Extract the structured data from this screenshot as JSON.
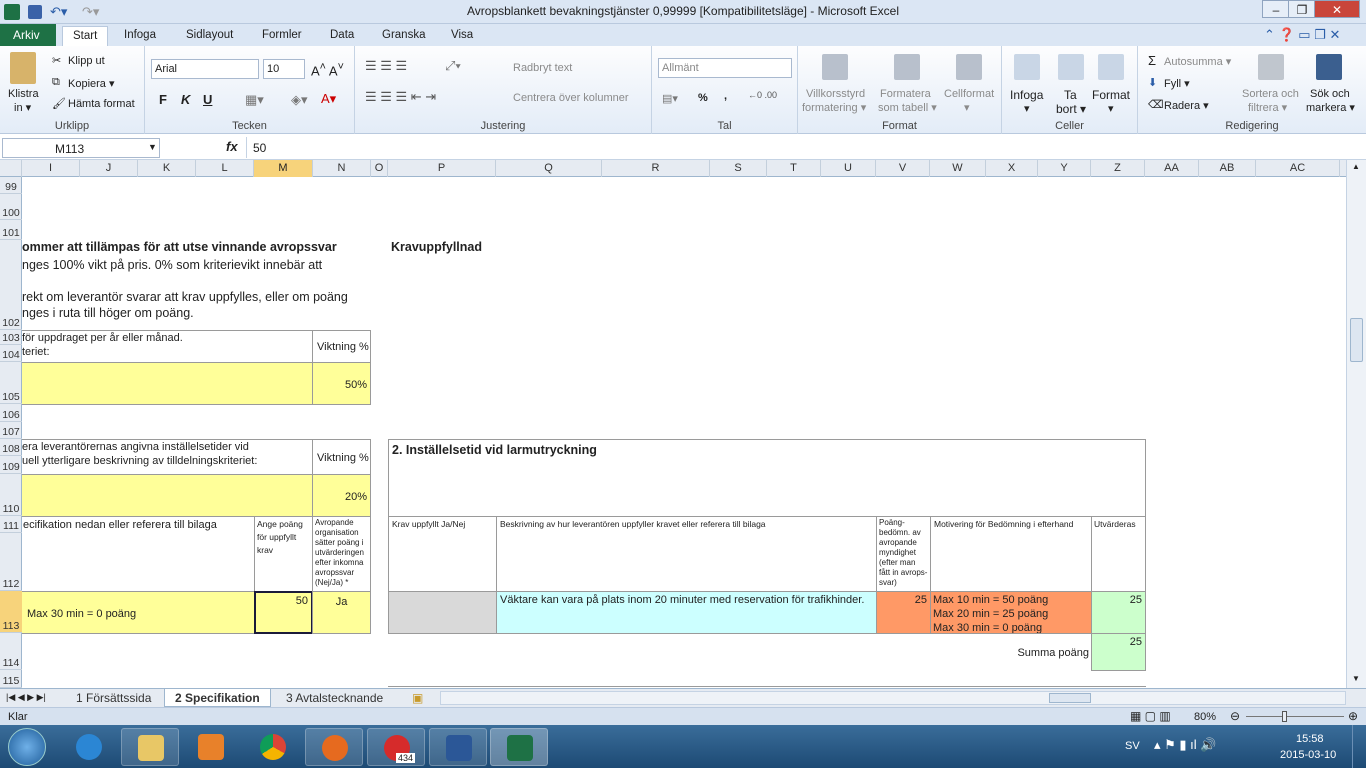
{
  "window": {
    "title": "Avropsblankett bevakningstjänster 0,99999  [Kompatibilitetsläge]  -  Microsoft Excel",
    "minimize": "–",
    "restore": "❐",
    "close": "✕"
  },
  "tabs": [
    "Arkiv",
    "Start",
    "Infoga",
    "Sidlayout",
    "Formler",
    "Data",
    "Granska",
    "Visa"
  ],
  "ribbon": {
    "clipboard": {
      "paste": "Klistra",
      "paste2": "in ▾",
      "cut": "Klipp ut",
      "copy": "Kopiera ▾",
      "format_painter": "Hämta format",
      "label": "Urklipp"
    },
    "font": {
      "name": "Arial",
      "size": "10",
      "bold": "F",
      "italic": "K",
      "underline": "U",
      "label": "Tecken"
    },
    "alignment": {
      "wrap": "Radbryt text",
      "merge": "Centrera över kolumner",
      "label": "Justering"
    },
    "number": {
      "format": "Allmänt",
      "percent": "%",
      "comma": ",",
      "label": "Tal"
    },
    "styles": {
      "conditional": "Villkorsstyrd",
      "conditional2": "formatering ▾",
      "table": "Formatera",
      "table2": "som tabell ▾",
      "cell": "Cellformat",
      "cell2": "▾",
      "label": "Format"
    },
    "cells": {
      "insert": "Infoga",
      "insert2": "▾",
      "delete": "Ta",
      "delete2": "bort ▾",
      "format": "Format",
      "format2": "▾",
      "label": "Celler"
    },
    "editing": {
      "autosum": "Autosumma ▾",
      "fill": "Fyll ▾",
      "clear": "Radera ▾",
      "sort": "Sortera och",
      "sort2": "filtrera ▾",
      "find": "Sök och",
      "find2": "markera ▾",
      "label": "Redigering"
    }
  },
  "formula_bar": {
    "name_box": "M113",
    "fx": "fx",
    "value": "50"
  },
  "columns": [
    "I",
    "J",
    "K",
    "L",
    "M",
    "N",
    "O",
    "P",
    "Q",
    "R",
    "S",
    "T",
    "U",
    "V",
    "W",
    "X",
    "Y",
    "Z",
    "AA",
    "AB",
    "AC"
  ],
  "selected_column": "M",
  "rows": [
    "99",
    "100",
    "101",
    "102",
    "103",
    "104",
    "105",
    "106",
    "107",
    "108",
    "109",
    "110",
    "111",
    "112",
    "113",
    "114",
    "115"
  ],
  "selected_row": "113",
  "cells": {
    "r101_heading": "ommer att tillämpas för att utse vinnande avropssvar",
    "r101_text": "nges 100% vikt på pris. 0% som kriterievikt innebär att",
    "r102_text1": "rekt om leverantör svarar att krav uppfylles, eller om poäng",
    "r102_text2": "nges i ruta till höger om poäng.",
    "kravuppfyllnad": "Kravuppfyllnad",
    "r103_text": " för uppdraget per år eller månad.",
    "r104_text": "teriet:",
    "viktning1": "Viktning %",
    "weight1": "50%",
    "r108_text": "era leverantörernas angivna inställelsetider vid",
    "r109_text": "uell ytterligare beskrivning av tilldelningskriteriet:",
    "viktning2": "Viktning %",
    "weight2": "20%",
    "section2_title": "2. Inställelsetid vid larmutryckning",
    "r111_text": "ecifikation nedan eller referera till bilaga",
    "ange_poang": "Ange poäng för uppfyllt krav",
    "avropande_org": "Avropande organisation sätter poäng i utvärderingen efter inkomna avropssvar (Nej/Ja) *",
    "krav_uppfyllt": "Krav uppfyllt Ja/Nej",
    "beskrivning": "Beskrivning av hur leverantören uppfyller kravet eller referera till bilaga",
    "poang_bedomn": "Poäng-bedömn. av avropande myndighet (efter man fått in avrops-svar)",
    "motivering": "Motivering för Bedömning i efterhand",
    "utvarderas": "Utvärderas",
    "r113_text": "Max 30 min = 0 poäng",
    "m113": "50",
    "n113": "Ja",
    "q113": "Väktare kan vara på plats inom 20 minuter med reservation för trafikhinder.",
    "v113": "25",
    "w113": [
      "Max 10 min = 50 poäng",
      "Max 20 min = 25 poäng",
      "Max 30 min = 0 poäng"
    ],
    "z113": "25",
    "summa_label": "Summa poäng",
    "z114": "25"
  },
  "sheet_tabs": [
    "1 Försättssida",
    "2 Specifikation",
    "3 Avtalstecknande"
  ],
  "active_sheet": "2 Specifikation",
  "status": {
    "mode": "Klar",
    "zoom": "80%"
  },
  "taskbar": {
    "lang": "SV",
    "time": "15:58",
    "date": "2015-03-10",
    "mail_badge": "434"
  },
  "colors": {
    "yellow": "#ffff99",
    "cyan": "#ccffff",
    "orange": "#ff9966",
    "green": "#ccffcc",
    "gray": "#d9d9d9",
    "excel_green": "#1e7145"
  }
}
